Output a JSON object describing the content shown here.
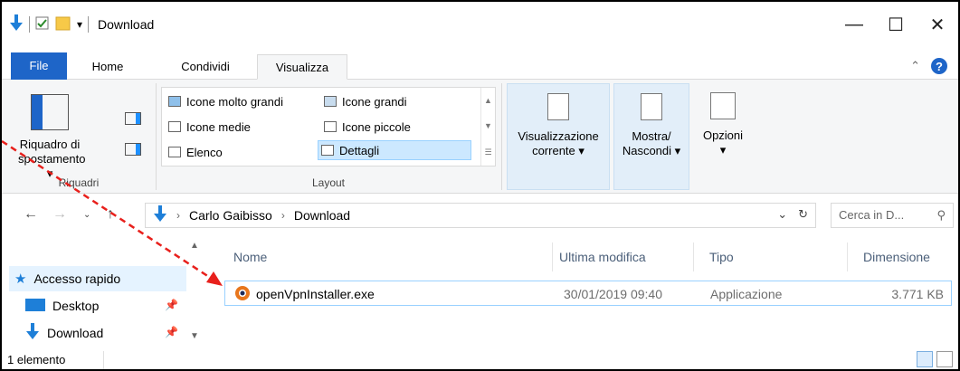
{
  "window": {
    "title": "Download",
    "minimize_glyph": "—",
    "maximize_glyph": "☐",
    "close_glyph": "✕"
  },
  "ribbon_tabs": {
    "file": "File",
    "home": "Home",
    "share": "Condividi",
    "view": "Visualizza"
  },
  "panes_group": {
    "nav_pane_label_1": "Riquadro di",
    "nav_pane_label_2": "spostamento ▾",
    "group_label": "Riquadri"
  },
  "layout_group": {
    "items": {
      "extra_large": "Icone molto grandi",
      "large": "Icone grandi",
      "medium": "Icone medie",
      "small": "Icone piccole",
      "list": "Elenco",
      "details": "Dettagli"
    },
    "group_label": "Layout"
  },
  "current_view": {
    "label_1": "Visualizzazione",
    "label_2": "corrente ▾"
  },
  "show_hide": {
    "label_1": "Mostra/",
    "label_2": "Nascondi ▾"
  },
  "options": {
    "label": "Opzioni",
    "caret": "▾"
  },
  "address_bar": {
    "crumbs": [
      "Carlo Gaibisso",
      "Download"
    ],
    "search_placeholder": "Cerca in D..."
  },
  "nav_pane": {
    "quick_access": "Accesso rapido",
    "desktop": "Desktop",
    "download": "Download"
  },
  "file_list": {
    "columns": {
      "name": "Nome",
      "modified": "Ultima modifica",
      "type": "Tipo",
      "size": "Dimensione"
    },
    "rows": [
      {
        "name": "openVpnInstaller.exe",
        "modified": "30/01/2019 09:40",
        "type": "Applicazione",
        "size": "3.771 KB"
      }
    ]
  },
  "status_bar": {
    "count": "1 elemento"
  },
  "colors": {
    "accent": "#1e65c8",
    "selection": "#cce8ff",
    "annotation_arrow": "#e8201c"
  }
}
